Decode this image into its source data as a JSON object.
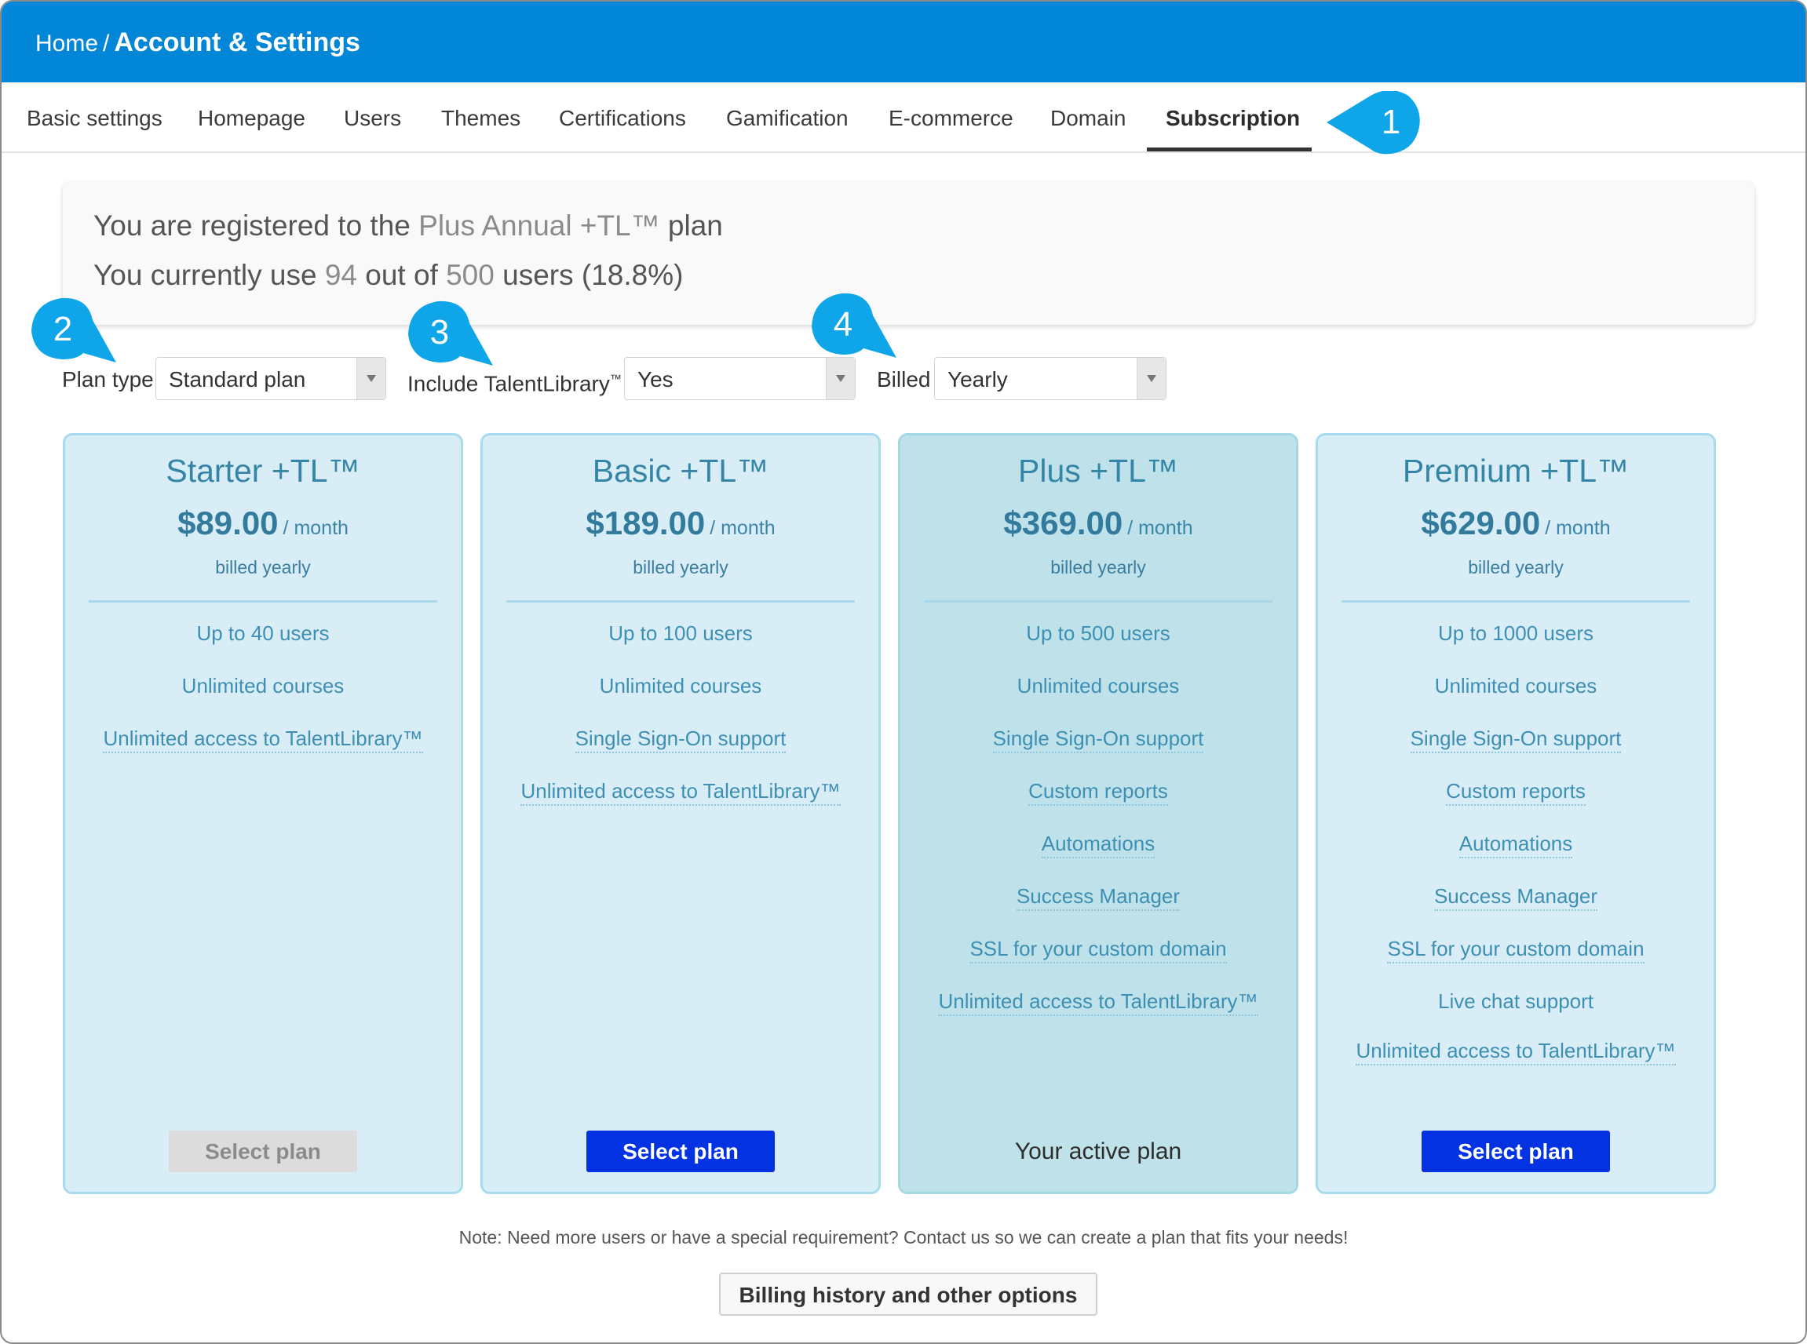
{
  "breadcrumb": {
    "home": "Home",
    "separator": "/",
    "current": "Account & Settings"
  },
  "tabs": [
    {
      "label": "Basic settings"
    },
    {
      "label": "Homepage"
    },
    {
      "label": "Users"
    },
    {
      "label": "Themes"
    },
    {
      "label": "Certifications"
    },
    {
      "label": "Gamification"
    },
    {
      "label": "E-commerce"
    },
    {
      "label": "Domain"
    },
    {
      "label": "Subscription",
      "active": true
    }
  ],
  "callouts": [
    "1",
    "2",
    "3",
    "4"
  ],
  "callout_color": "#0ea5e9",
  "info": {
    "line1_prefix": "You are registered to the",
    "plan_name": "Plus Annual +TL™",
    "line1_suffix": "plan",
    "line2_prefix": "You currently use",
    "used": "94",
    "line2_mid": "out of",
    "total": "500",
    "line2_suffix": "users (18.8%)"
  },
  "filters": {
    "plan_type": {
      "label": "Plan type",
      "value": "Standard plan"
    },
    "talentlibrary": {
      "label": "Include TalentLibrary",
      "tm": "™",
      "value": "Yes"
    },
    "billed": {
      "label": "Billed",
      "value": "Yearly"
    }
  },
  "plans": [
    {
      "name": "Starter +TL™",
      "price": "$89.00",
      "per": "/ month",
      "billed": "billed yearly",
      "features": [
        "Up to 40 users",
        "Unlimited courses",
        "Unlimited access to TalentLibrary™"
      ],
      "button": "Select plan"
    },
    {
      "name": "Basic +TL™",
      "price": "$189.00",
      "per": "/ month",
      "billed": "billed yearly",
      "features": [
        "Up to 100 users",
        "Unlimited courses",
        "Single Sign-On support",
        "Unlimited access to TalentLibrary™"
      ],
      "button": "Select plan"
    },
    {
      "name": "Plus +TL™",
      "price": "$369.00",
      "per": "/ month",
      "billed": "billed yearly",
      "features": [
        "Up to 500 users",
        "Unlimited courses",
        "Single Sign-On support",
        "Custom reports",
        "Automations",
        "Success Manager",
        "SSL for your custom domain",
        "Unlimited access to TalentLibrary™"
      ],
      "button": "Your active plan"
    },
    {
      "name": "Premium +TL™",
      "price": "$629.00",
      "per": "/ month",
      "billed": "billed yearly",
      "features": [
        "Up to 1000 users",
        "Unlimited courses",
        "Single Sign-On support",
        "Custom reports",
        "Automations",
        "Success Manager",
        "SSL for your custom domain",
        "Live chat support",
        "Unlimited access to TalentLibrary™"
      ],
      "button": "Select plan"
    }
  ],
  "note": "Note: Need more users or have a special requirement? Contact us so we can create a plan that fits your needs!",
  "billing_button": "Billing history and other options",
  "colors": {
    "header": "#0186d8",
    "primary_button": "#0332e2",
    "card_bg": "#d9edf7",
    "active_card_bg": "#bfe2ea"
  }
}
